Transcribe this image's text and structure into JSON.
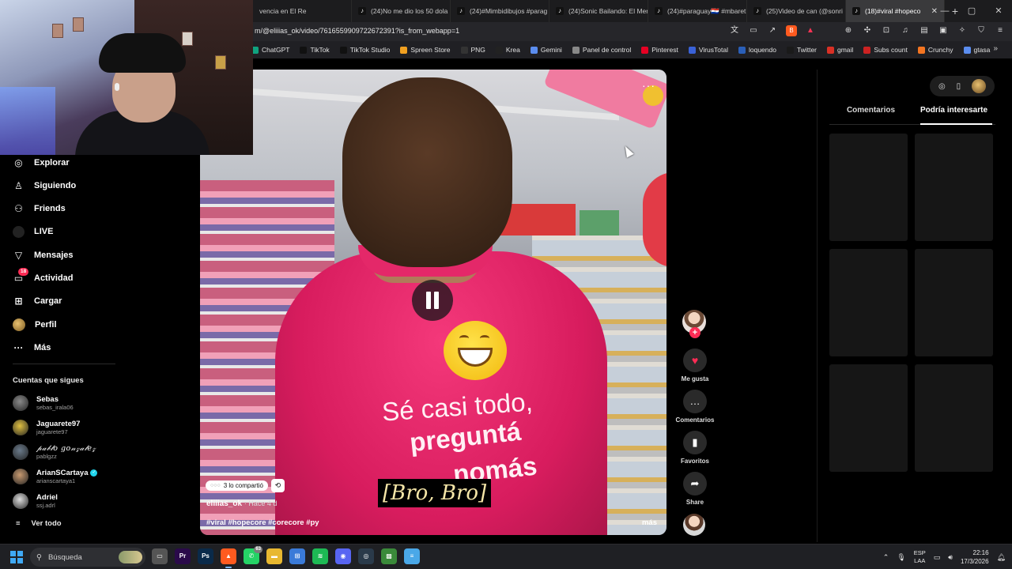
{
  "browser": {
    "tabs": [
      {
        "label": "vencia en El Re"
      },
      {
        "label": "(24)No me dio los 50 dola"
      },
      {
        "label": "(24)#Mimbidibujos #parag"
      },
      {
        "label": "(24)Sonic Bailando: El Men"
      },
      {
        "label": "(24)#paraguay🇵🇾 #mbaret"
      },
      {
        "label": "(25)Video de can (@sonri"
      },
      {
        "label": "(18)#viral #hopeco"
      }
    ],
    "url": "m/@eliiias_ok/video/7616559909722672391?is_from_webapp=1",
    "bookmarks": [
      {
        "label": "ChatGPT",
        "color": "#10a37f"
      },
      {
        "label": "TikTok",
        "color": "#111111"
      },
      {
        "label": "TikTok Studio",
        "color": "#111111"
      },
      {
        "label": "Spreen Store",
        "color": "#f0a020"
      },
      {
        "label": "PNG",
        "color": "#333333"
      },
      {
        "label": "Krea",
        "color": "#222222"
      },
      {
        "label": "Gemini",
        "color": "#5b8def"
      },
      {
        "label": "Panel de control",
        "color": "#888888"
      },
      {
        "label": "Pinterest",
        "color": "#e60023"
      },
      {
        "label": "VirusTotal",
        "color": "#3a62d8"
      },
      {
        "label": "loquendo",
        "color": "#2a5fb8"
      },
      {
        "label": "Twitter",
        "color": "#1a1a1a"
      },
      {
        "label": "gmail",
        "color": "#d93025"
      },
      {
        "label": "Subs count",
        "color": "#cc2222"
      },
      {
        "label": "Crunchy",
        "color": "#f47521"
      },
      {
        "label": "gtasa",
        "color": "#5b8def"
      }
    ]
  },
  "sidebar": {
    "nav": [
      {
        "label": "Explorar",
        "icon": "compass-icon"
      },
      {
        "label": "Siguiendo",
        "icon": "following-icon"
      },
      {
        "label": "Friends",
        "icon": "friends-icon"
      },
      {
        "label": "LIVE",
        "icon": "live-icon"
      },
      {
        "label": "Mensajes",
        "icon": "messages-icon"
      },
      {
        "label": "Actividad",
        "icon": "activity-icon",
        "badge": "18"
      },
      {
        "label": "Cargar",
        "icon": "upload-icon"
      },
      {
        "label": "Perfil",
        "icon": "profile-avatar"
      },
      {
        "label": "Más",
        "icon": "more-icon"
      }
    ],
    "following_title": "Cuentas que sigues",
    "accounts": [
      {
        "name": "Sebas",
        "handle": "sebas_irala06",
        "color": "#8a8a8a"
      },
      {
        "name": "Jaguarete97",
        "handle": "jaguarete97",
        "color": "#e0c040"
      },
      {
        "name": "𝓅𝒶𝒷𝓁𝑜 𝑔𝑜𝓃𝓏𝒶𝓁𝑒𝓏",
        "handle": "pablgzz",
        "color": "#6a7a8a"
      },
      {
        "name": "ArianSCartaya",
        "handle": "arianscartaya1",
        "color": "#c89a70",
        "verified": true
      },
      {
        "name": "Adriel",
        "handle": "ssj.adrl",
        "color": "#dddddd"
      }
    ],
    "see_all": "Ver todo"
  },
  "video": {
    "shirt_line1": "Sé casi todo,",
    "shirt_line2": "preguntá",
    "shirt_line3": "nomás",
    "subtitle": "[Bro, Bro]",
    "shared_text": "3 lo compartió",
    "author": "eliiias_ok",
    "time": "· Hace 4 d",
    "hashtags": "#viral #hopecore #corecore #py",
    "more": "más"
  },
  "actions": {
    "like": "Me gusta",
    "comments": "Comentarios",
    "favorites": "Favoritos",
    "share": "Share"
  },
  "right_panel": {
    "tabs": [
      {
        "label": "Comentarios"
      },
      {
        "label": "Podría interesarte",
        "active": true
      }
    ]
  },
  "taskbar": {
    "search_placeholder": "Búsqueda",
    "apps": [
      {
        "name": "task-view",
        "color": "#555555",
        "glyph": "▭"
      },
      {
        "name": "premiere",
        "color": "#2a0a4a",
        "glyph": "Pr"
      },
      {
        "name": "photoshop",
        "color": "#0a2a4a",
        "glyph": "Ps"
      },
      {
        "name": "brave",
        "color": "#ff5a1f",
        "glyph": "▲",
        "active": true
      },
      {
        "name": "whatsapp",
        "color": "#25d366",
        "glyph": "✆",
        "badge": "63"
      },
      {
        "name": "file-explorer",
        "color": "#e8b830",
        "glyph": "▬"
      },
      {
        "name": "store",
        "color": "#3a7ad8",
        "glyph": "⊞"
      },
      {
        "name": "spotify",
        "color": "#1db954",
        "glyph": "≋"
      },
      {
        "name": "discord",
        "color": "#5865f2",
        "glyph": "◉"
      },
      {
        "name": "steam",
        "color": "#2a3a4a",
        "glyph": "◎"
      },
      {
        "name": "minecraft",
        "color": "#3a8a3a",
        "glyph": "▩"
      },
      {
        "name": "notepad",
        "color": "#4aa8e8",
        "glyph": "≡"
      }
    ],
    "lang_top": "ESP",
    "lang_bottom": "LAA",
    "time": "22:16",
    "date": "17/3/2026"
  }
}
